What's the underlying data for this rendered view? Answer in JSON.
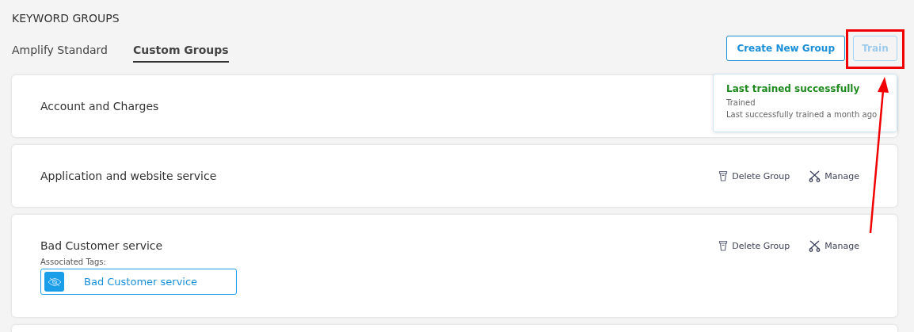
{
  "title": "KEYWORD GROUPS",
  "tabs": [
    {
      "label": "Amplify Standard",
      "selected": false
    },
    {
      "label": "Custom Groups",
      "selected": true
    }
  ],
  "buttons": [
    {
      "label": "Create New Group",
      "disabled": false
    },
    {
      "label": "Train",
      "disabled": true
    }
  ],
  "tooltip": {
    "title": "Last trained successfully",
    "status": "Trained",
    "detail": "Last successfully trained a month ago"
  },
  "groups": [
    {
      "name": "Account and Charges"
    },
    {
      "name": "Application and website service",
      "actions": [
        {
          "label": "Delete Group",
          "kind": "delete"
        },
        {
          "label": "Manage",
          "kind": "manage"
        }
      ]
    },
    {
      "name": "Bad Customer service",
      "actions": [
        {
          "label": "Delete Group",
          "kind": "delete"
        },
        {
          "label": "Manage",
          "kind": "manage"
        }
      ],
      "tags_label": "Associated Tags:",
      "tags": [
        {
          "label": "Bad Customer service"
        }
      ]
    }
  ],
  "annotation": {
    "highlight_box": true,
    "arrow": true
  }
}
